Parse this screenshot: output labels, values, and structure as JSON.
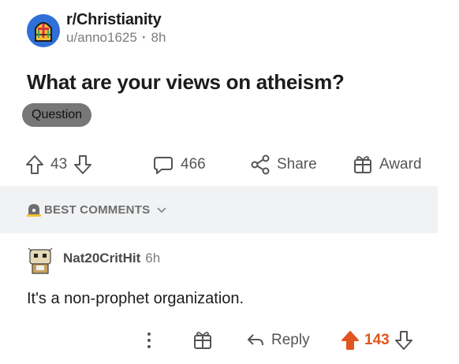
{
  "post": {
    "subreddit": "r/Christianity",
    "author": "u/anno1625",
    "age": "8h",
    "title": "What are your views on atheism?",
    "flair": "Question",
    "upvotes": "43",
    "comments": "466",
    "share_label": "Share",
    "award_label": "Award"
  },
  "best_comments": {
    "label": "BEST COMMENTS"
  },
  "comment": {
    "author": "Nat20CritHit",
    "age": "6h",
    "body": "It's a non-prophet organization.",
    "reply_label": "Reply",
    "score": "143"
  },
  "colors": {
    "upvote_active": "#e2551f",
    "flair_bg": "#777777",
    "subreddit_icon_bg": "#2e6fd8"
  },
  "icons": [
    "church-window-icon",
    "upvote-icon",
    "downvote-icon",
    "comment-bubble-icon",
    "share-icon",
    "award-gift-icon",
    "lock-bell-icon",
    "chevron-down-icon",
    "avatar-icon",
    "more-vertical-icon",
    "reply-arrow-icon"
  ]
}
